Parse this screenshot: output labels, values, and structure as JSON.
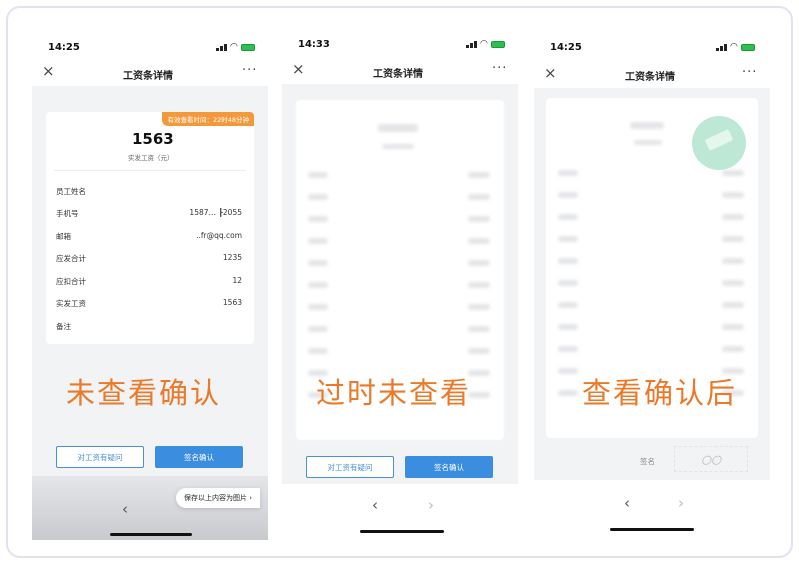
{
  "phones": [
    {
      "status_time": "14:25",
      "nav_title": "工资条详情",
      "badge": "有效查看时间：22时48分钟",
      "amount": "1563",
      "amount_label": "实发工资（元）",
      "rows": [
        {
          "label": "员工姓名",
          "value": ""
        },
        {
          "label": "手机号",
          "value": "1587… ┠2055"
        },
        {
          "label": "邮箱",
          "value": "..fr@qq.com"
        },
        {
          "label": "应发合计",
          "value": "1235"
        },
        {
          "label": "应扣合计",
          "value": "12"
        },
        {
          "label": "实发工资",
          "value": "1563"
        },
        {
          "label": "备注",
          "value": ""
        }
      ],
      "question_button": "对工资有疑问",
      "confirm_button": "签名确认",
      "save_image": "保存以上内容为图片 ›",
      "caption": "未查看确认"
    },
    {
      "status_time": "14:33",
      "nav_title": "工资条详情",
      "question_button": "对工资有疑问",
      "confirm_button": "签名确认",
      "caption": "过时未查看"
    },
    {
      "status_time": "14:25",
      "nav_title": "工资条详情",
      "sign_label": "签名",
      "signature": "〇〇",
      "caption": "查看确认后"
    }
  ],
  "icons": {
    "close": "×",
    "more": "···",
    "back": "‹",
    "forward": "›"
  },
  "colors": {
    "accent_orange": "#ea7a2a",
    "button_blue": "#3b8de0",
    "stamp_green": "#86d6b2"
  }
}
